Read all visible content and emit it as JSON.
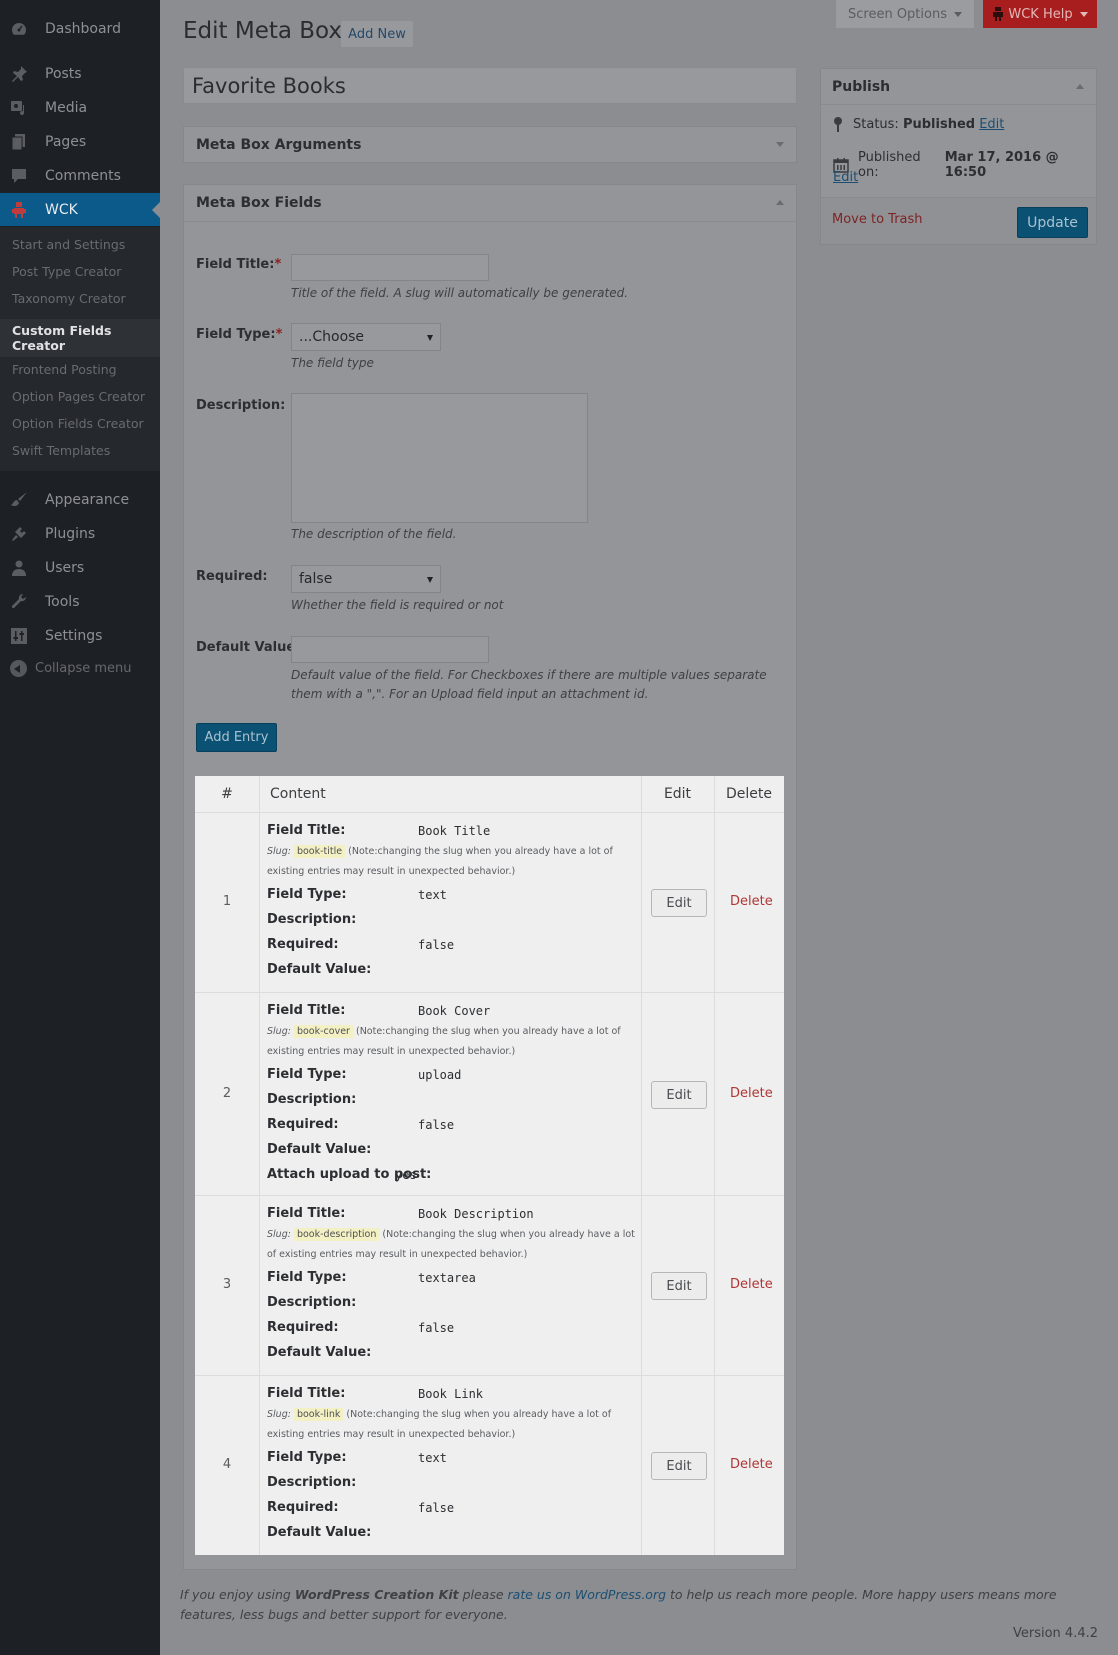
{
  "sidebar": {
    "items": [
      {
        "label": "Dashboard",
        "icon": "dashboard-icon"
      },
      {
        "label": "Posts",
        "icon": "pin-icon"
      },
      {
        "label": "Media",
        "icon": "media-icon"
      },
      {
        "label": "Pages",
        "icon": "pages-icon"
      },
      {
        "label": "Comments",
        "icon": "comment-icon"
      },
      {
        "label": "WCK",
        "icon": "robot-icon",
        "active": true
      },
      {
        "label": "Appearance",
        "icon": "brush-icon"
      },
      {
        "label": "Plugins",
        "icon": "plug-icon"
      },
      {
        "label": "Users",
        "icon": "user-icon"
      },
      {
        "label": "Tools",
        "icon": "wrench-icon"
      },
      {
        "label": "Settings",
        "icon": "sliders-icon"
      }
    ],
    "submenu": [
      "Start and Settings",
      "Post Type Creator",
      "Taxonomy Creator",
      "Custom Fields Creator",
      "Frontend Posting",
      "Option Pages Creator",
      "Option Fields Creator",
      "Swift Templates"
    ],
    "submenu_current": 3,
    "collapse_label": "Collapse menu"
  },
  "topbar": {
    "screen_options": "Screen Options",
    "wck_help": "WCK Help"
  },
  "header": {
    "title": "Edit Meta Box",
    "add_new": "Add New",
    "post_title": "Favorite Books"
  },
  "metabox_arguments": {
    "title": "Meta Box Arguments"
  },
  "metabox_fields": {
    "title": "Meta Box Fields",
    "field_title_label": "Field Title:",
    "field_title_value": "",
    "field_title_hint": "Title of the field. A slug will automatically be generated.",
    "field_type_label": "Field Type:",
    "field_type_value": "...Choose",
    "field_type_hint": "The field type",
    "description_label": "Description:",
    "description_value": "",
    "description_hint": "The description of the field.",
    "required_label": "Required:",
    "required_value": "false",
    "required_hint": "Whether the field is required or not",
    "default_label": "Default Value:",
    "default_value": "",
    "default_hint": "Default value of the field. For Checkboxes if there are multiple values separate them with a \",\". For an Upload field input an attachment id.",
    "required_marker": "*",
    "add_entry": "Add Entry"
  },
  "table": {
    "headers": {
      "num": "#",
      "content": "Content",
      "edit": "Edit",
      "delete": "Delete"
    },
    "slug_prefix": "Slug:",
    "slug_note": "(Note:changing the slug when you already have a lot of existing entries may result in unexpected behavior.)",
    "edit_label": "Edit",
    "delete_label": "Delete",
    "labels": {
      "field_title": "Field Title:",
      "field_type": "Field Type:",
      "description": "Description:",
      "required": "Required:",
      "default": "Default Value:",
      "attach": "Attach upload to post:"
    },
    "rows": [
      {
        "num": "1",
        "title": "Book Title",
        "slug": "book-title",
        "type": "text",
        "description": "",
        "required": "false",
        "default": ""
      },
      {
        "num": "2",
        "title": "Book Cover",
        "slug": "book-cover",
        "type": "upload",
        "description": "",
        "required": "false",
        "default": "",
        "attach": "yes"
      },
      {
        "num": "3",
        "title": "Book Description",
        "slug": "book-description",
        "type": "textarea",
        "description": "",
        "required": "false",
        "default": ""
      },
      {
        "num": "4",
        "title": "Book Link",
        "slug": "book-link",
        "type": "text",
        "description": "",
        "required": "false",
        "default": ""
      }
    ]
  },
  "publish": {
    "title": "Publish",
    "status_label": "Status:",
    "status_value": "Published",
    "status_edit": "Edit",
    "published_on_label": "Published on:",
    "published_on_value": "Mar 17, 2016 @ 16:50",
    "date_edit": "Edit",
    "trash": "Move to Trash",
    "update": "Update"
  },
  "footer": {
    "text_1": "If you enjoy using ",
    "brand": "WordPress Creation Kit",
    "text_2": " please ",
    "link": "rate us on WordPress.org",
    "text_3": " to help us reach more people. More happy users means more features, less bugs and better support for everyone.",
    "version": "Version 4.4.2"
  },
  "colors": {
    "accent": "#0b5173",
    "sidebar_active": "#0b5a8a",
    "help_tab": "#a81d1d",
    "delete": "#b03535",
    "slug_highlight": "#f3f0c4"
  }
}
